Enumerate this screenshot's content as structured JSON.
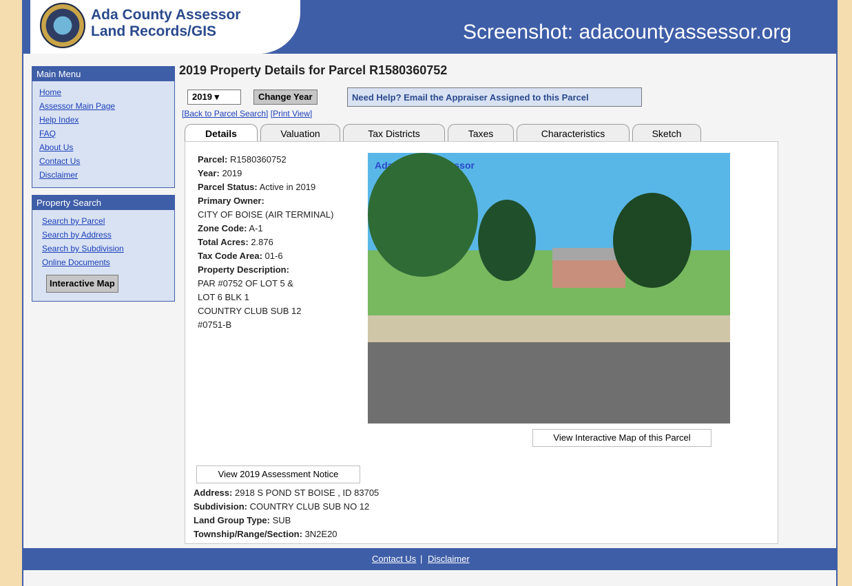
{
  "header": {
    "logo_line1": "Ada County Assessor",
    "logo_line2": "Land Records/GIS",
    "credit": "Screenshot: adacountyassessor.org"
  },
  "leftnav": {
    "main_menu_title": "Main Menu",
    "main_links": [
      "Home",
      "Assessor Main Page",
      "Help Index",
      "FAQ",
      "About Us",
      "Contact Us",
      "Disclaimer"
    ],
    "property_search_title": "Property Search",
    "search_links": [
      "Search by Parcel",
      "Search by Address",
      "Search by Subdivision",
      "Online Documents"
    ],
    "interactive_map": "Interactive Map"
  },
  "main": {
    "title": "2019 Property Details for Parcel R1580360752",
    "year_select": "2019",
    "change_year": "Change Year",
    "help_button": "Need Help? Email the Appraiser Assigned to this Parcel",
    "back_link": "[Back to Parcel Search]",
    "print_link": "[Print View]",
    "tabs": [
      "Details",
      "Valuation",
      "Tax Districts",
      "Taxes",
      "Characteristics",
      "Sketch"
    ],
    "details": {
      "parcel_label": "Parcel:",
      "parcel": "R1580360752",
      "year_label": "Year:",
      "year": "2019",
      "status_label": "Parcel Status:",
      "status": "Active in 2019",
      "owner_label": "Primary Owner:",
      "owner": "CITY OF BOISE (AIR TERMINAL)",
      "zone_label": "Zone Code:",
      "zone": "A-1",
      "acres_label": "Total Acres:",
      "acres": "2.876",
      "tax_code_label": "Tax Code Area:",
      "tax_code": "01-6",
      "description_label": "Property Description:",
      "description_1": "PAR #0752 OF LOT 5 &",
      "description_2": "LOT 6 BLK 1",
      "description_3": "COUNTRY CLUB SUB 12",
      "description_4": "#0751-B"
    },
    "photo_watermark": "Ada County Assessor",
    "view_map_button": "View Interactive Map of this Parcel",
    "assessment_notice_button": "View 2019 Assessment Notice",
    "address_label": "Address:",
    "address": "2918 S POND ST BOISE , ID 83705",
    "subdivision_label": "Subdivision:",
    "subdivision": "COUNTRY CLUB SUB NO 12",
    "land_group_label": "Land Group Type:",
    "land_group": "SUB",
    "trs_label": "Township/Range/Section:",
    "trs": "3N2E20"
  },
  "footer": {
    "contact": "Contact Us",
    "separator": "|",
    "disclaimer": "Disclaimer"
  }
}
